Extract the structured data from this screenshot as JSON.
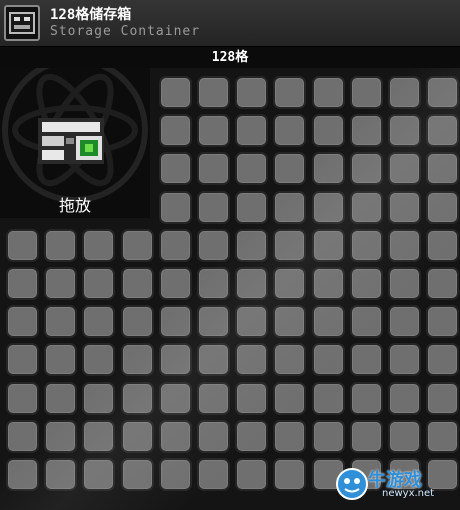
{
  "window": {
    "title": "128格储存箱",
    "subtitle": "Storage Container",
    "icon": "storage-container-icon"
  },
  "capacity_label": "128格",
  "preview": {
    "drag_label": "拖放",
    "item_icon": "storage-chest-icon"
  },
  "grid": {
    "columns": 12,
    "rows": 11,
    "visible_slots": 128,
    "slot_color": "#6f6f6f",
    "border_color": "#252525"
  },
  "watermark": {
    "brand": "牛游戏",
    "url": "newyx.net"
  }
}
